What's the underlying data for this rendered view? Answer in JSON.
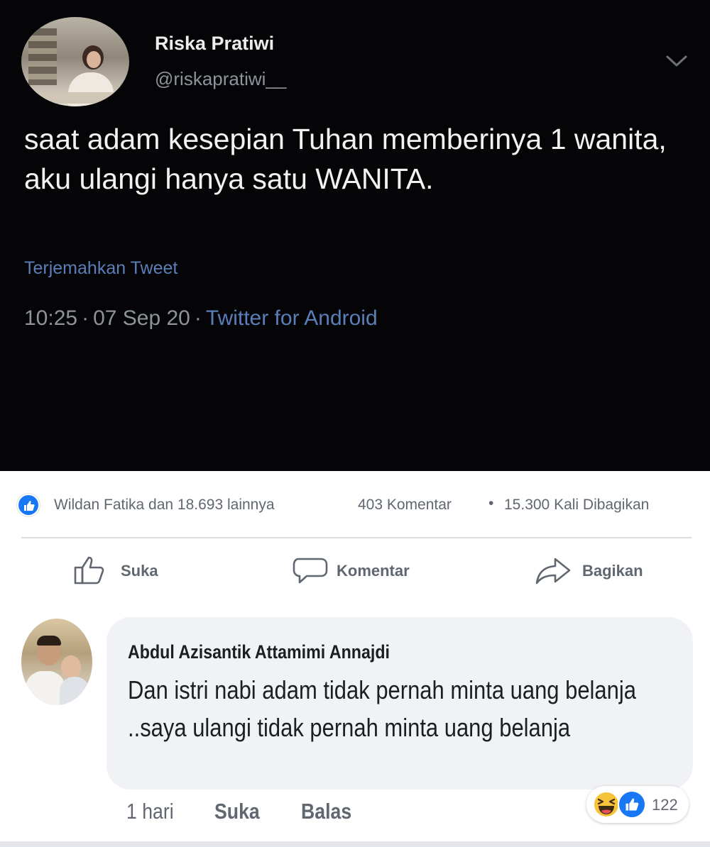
{
  "tweet": {
    "name": "Riska Pratiwi",
    "handle": "@riskapratiwi__",
    "text": "saat adam kesepian Tuhan memberinya 1 wanita, aku ulangi hanya satu WANITA.",
    "translate_link": "Terjemahkan Tweet",
    "time": "10:25",
    "date": "07 Sep 20",
    "separator": "·",
    "source": "Twitter for Android",
    "avatar_icon": "profile-photo",
    "menu_icon": "chevron-down-icon"
  },
  "post": {
    "reactors": "Wildan Fatika dan 18.693 lainnya",
    "comments": "403 Komentar",
    "dot": "•",
    "shares": "15.300 Kali Dibagikan",
    "actions": {
      "like": "Suka",
      "comment": "Komentar",
      "share": "Bagikan"
    }
  },
  "comment": {
    "author": "Abdul Azisantik Attamimi Annajdi",
    "text": "Dan istri nabi adam tidak pernah minta uang belanja ..saya ulangi tidak pernah minta uang belanja",
    "time": "1 hari",
    "like": "Suka",
    "reply": "Balas",
    "reaction_count": "122"
  },
  "colors": {
    "tweet_bg": "#050507",
    "link_blue": "#5a7fb8",
    "fb_blue": "#1877f2",
    "bubble_bg": "#f0f2f5",
    "muted_text": "#606770"
  }
}
